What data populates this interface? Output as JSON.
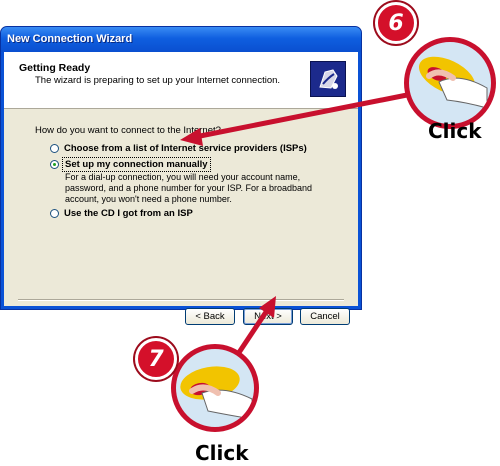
{
  "window": {
    "title": "New Connection Wizard",
    "header_title": "Getting Ready",
    "header_subtitle": "The wizard is preparing to set up your Internet connection.",
    "question": "How do you want to connect to the Internet?",
    "options": [
      {
        "label": "Choose from a list of Internet service providers (ISPs)",
        "selected": false
      },
      {
        "label": "Set up my connection manually",
        "selected": true
      },
      {
        "label": "Use the CD I got from an ISP",
        "selected": false
      }
    ],
    "manual_description": "For a dial-up connection, you will need your account name, password, and a phone number for your ISP. For a broadband account, you won't need a phone number.",
    "buttons": {
      "back": "< Back",
      "next": "Next >",
      "cancel": "Cancel"
    }
  },
  "callouts": [
    {
      "step": "6",
      "caption": "Click"
    },
    {
      "step": "7",
      "caption": "Click"
    }
  ],
  "colors": {
    "accent_red": "#c8102e",
    "titlebar_blue": "#0a52d6",
    "dialog_bg": "#ece9d8"
  }
}
